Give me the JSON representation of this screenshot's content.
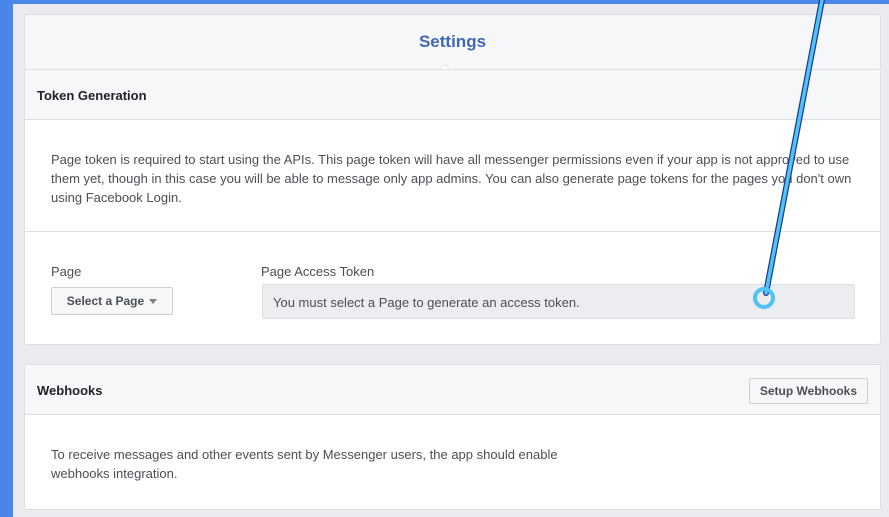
{
  "header": {
    "title": "Settings"
  },
  "token_generation": {
    "title": "Token Generation",
    "description": "Page token is required to start using the APIs. This page token will have all messenger permissions even if your app is not approved to use them yet, though in this case you will be able to message only app admins. You can also generate page tokens for the pages you don't own using Facebook Login.",
    "page_label": "Page",
    "select_label": "Select a Page",
    "token_label": "Page Access Token",
    "token_placeholder": "You must select a Page to generate an access token."
  },
  "webhooks": {
    "title": "Webhooks",
    "setup_label": "Setup Webhooks",
    "description": "To receive messages and other events sent by Messenger users, the app should enable webhooks integration."
  },
  "colors": {
    "accent": "#4a86e8",
    "pointer": "#4fc3f7",
    "link": "#4267b2"
  }
}
